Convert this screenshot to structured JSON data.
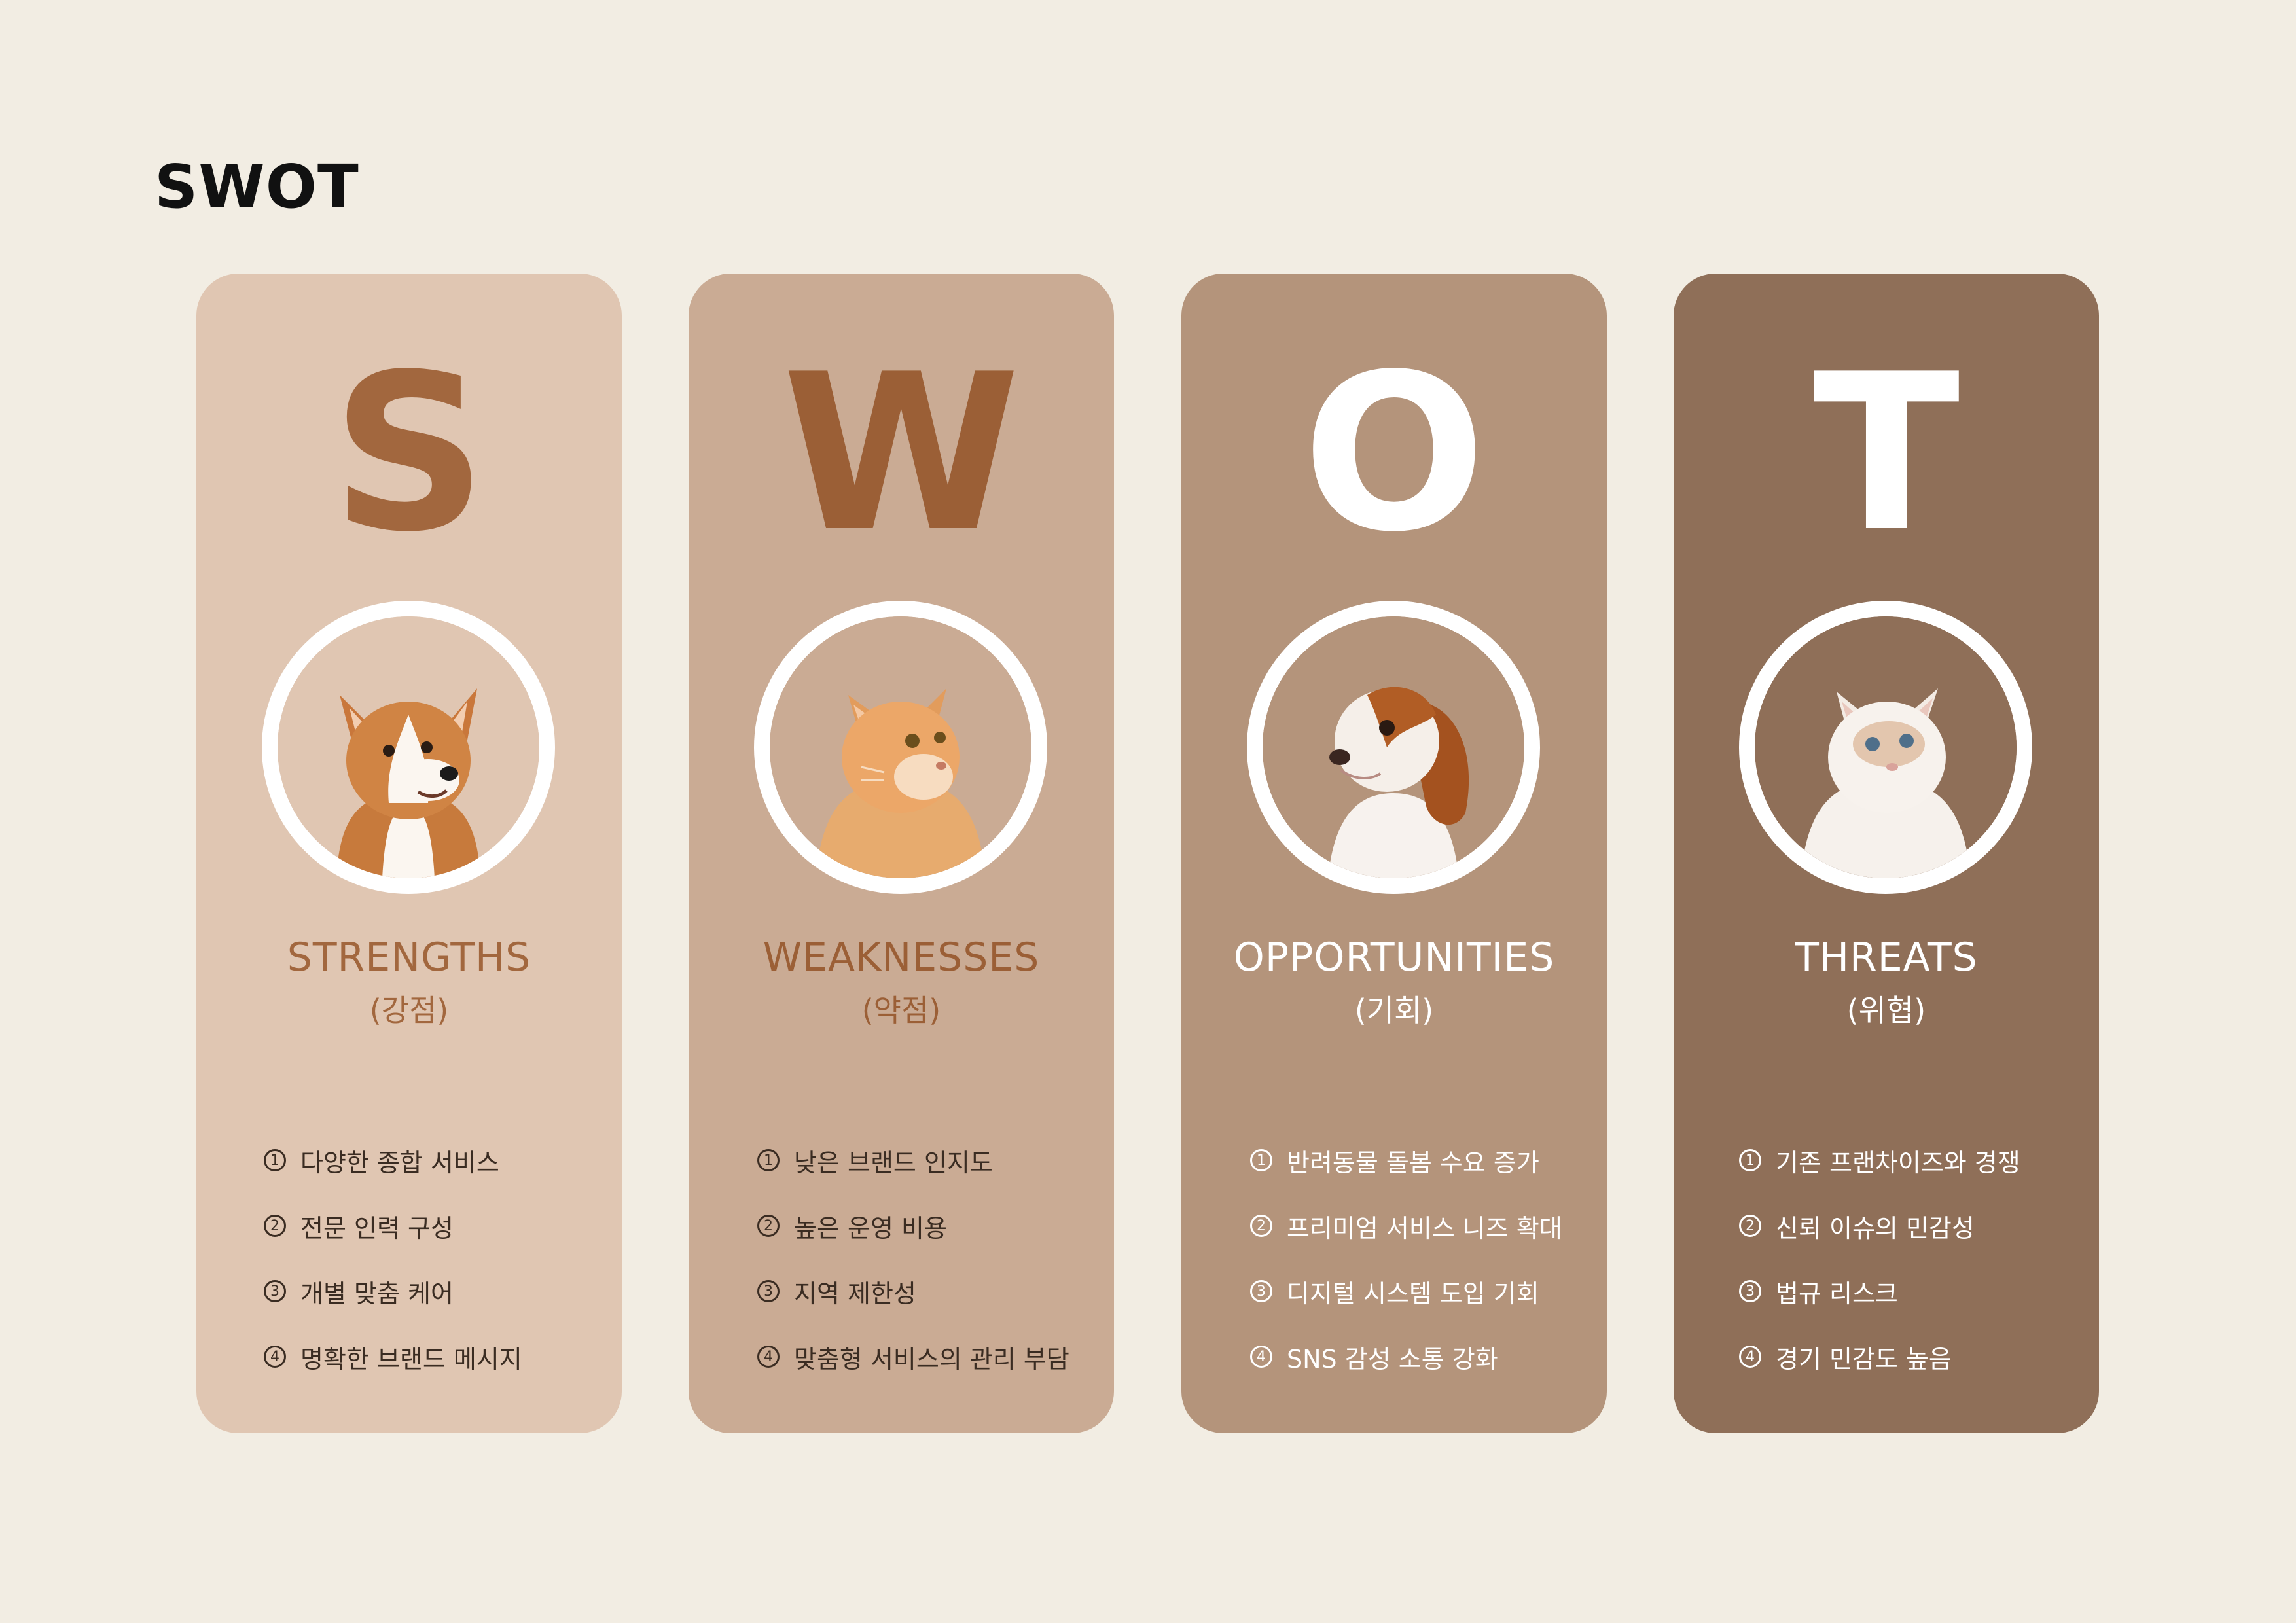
{
  "title": "SWOT",
  "cards": [
    {
      "key": "s",
      "letter": "S",
      "heading": "STRENGTHS",
      "subheading": "(강점)",
      "image": "corgi-dog",
      "color": "#e0c6b2",
      "accent": "#a2673e",
      "items": [
        {
          "num": "1",
          "text": "다양한 종합 서비스"
        },
        {
          "num": "2",
          "text": "전문 인력 구성"
        },
        {
          "num": "3",
          "text": "개별 맞춤 케어"
        },
        {
          "num": "4",
          "text": "명확한 브랜드 메시지"
        }
      ]
    },
    {
      "key": "w",
      "letter": "W",
      "heading": "WEAKNESSES",
      "subheading": "(약점)",
      "image": "orange-cat",
      "color": "#caab94",
      "accent": "#9b5f36",
      "items": [
        {
          "num": "1",
          "text": "낮은 브랜드 인지도"
        },
        {
          "num": "2",
          "text": "높은 운영 비용"
        },
        {
          "num": "3",
          "text": "지역 제한성"
        },
        {
          "num": "4",
          "text": "맞춤형 서비스의 관리 부담"
        }
      ]
    },
    {
      "key": "o",
      "letter": "O",
      "heading": "OPPORTUNITIES",
      "subheading": "(기회)",
      "image": "spaniel-dog",
      "color": "#b4947b",
      "accent": "#ffffff",
      "items": [
        {
          "num": "1",
          "text": "반려동물 돌봄 수요 증가"
        },
        {
          "num": "2",
          "text": "프리미엄 서비스 니즈 확대"
        },
        {
          "num": "3",
          "text": "디지털 시스템 도입 기회"
        },
        {
          "num": "4",
          "text": "SNS 감성 소통 강화"
        }
      ]
    },
    {
      "key": "t",
      "letter": "T",
      "heading": "THREATS",
      "subheading": "(위협)",
      "image": "white-cat",
      "color": "#8f6f58",
      "accent": "#ffffff",
      "items": [
        {
          "num": "1",
          "text": "기존 프랜차이즈와 경쟁"
        },
        {
          "num": "2",
          "text": "신뢰 이슈의 민감성"
        },
        {
          "num": "3",
          "text": "법규 리스크"
        },
        {
          "num": "4",
          "text": "경기 민감도 높음"
        }
      ]
    }
  ]
}
